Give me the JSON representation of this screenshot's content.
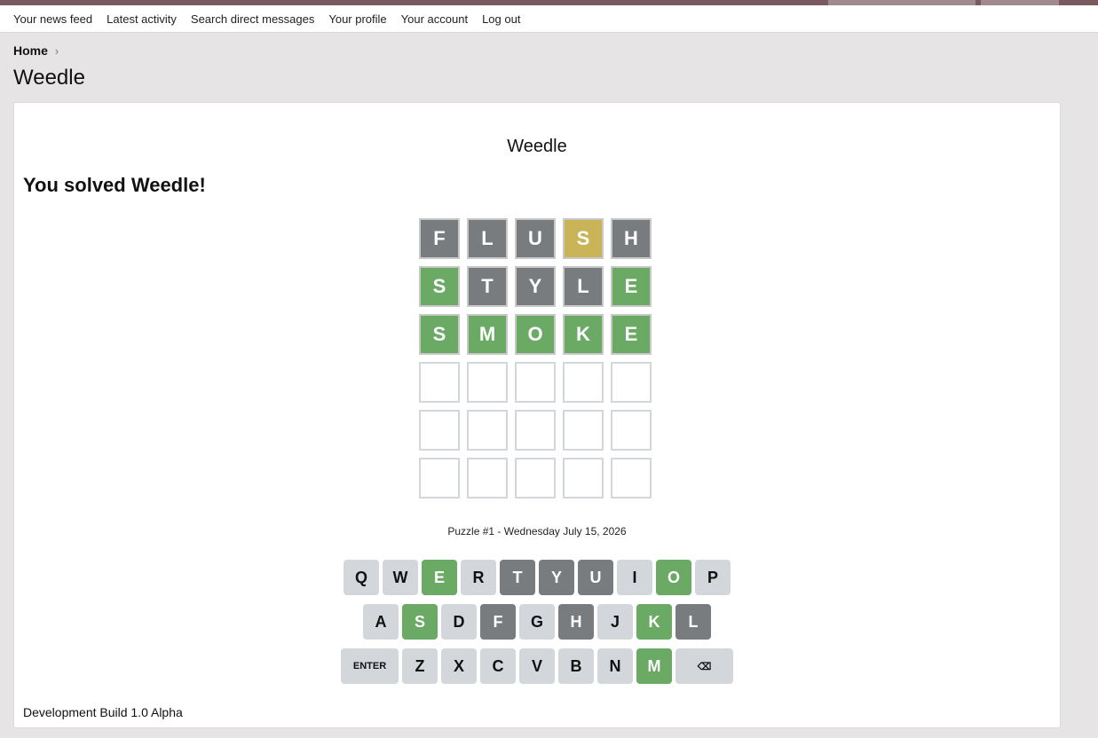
{
  "nav": {
    "items": [
      "Your news feed",
      "Latest activity",
      "Search direct messages",
      "Your profile",
      "Your account",
      "Log out"
    ]
  },
  "breadcrumb": {
    "home": "Home",
    "chevron": "›"
  },
  "page": {
    "title": "Weedle"
  },
  "game": {
    "title": "Weedle",
    "solved_message": "You solved Weedle!",
    "board": [
      [
        {
          "l": "F",
          "s": "grey"
        },
        {
          "l": "L",
          "s": "grey"
        },
        {
          "l": "U",
          "s": "grey"
        },
        {
          "l": "S",
          "s": "yellow"
        },
        {
          "l": "H",
          "s": "grey"
        }
      ],
      [
        {
          "l": "S",
          "s": "green"
        },
        {
          "l": "T",
          "s": "grey"
        },
        {
          "l": "Y",
          "s": "grey"
        },
        {
          "l": "L",
          "s": "grey"
        },
        {
          "l": "E",
          "s": "green"
        }
      ],
      [
        {
          "l": "S",
          "s": "green"
        },
        {
          "l": "M",
          "s": "green"
        },
        {
          "l": "O",
          "s": "green"
        },
        {
          "l": "K",
          "s": "green"
        },
        {
          "l": "E",
          "s": "green"
        }
      ],
      [
        {
          "l": "",
          "s": "empty"
        },
        {
          "l": "",
          "s": "empty"
        },
        {
          "l": "",
          "s": "empty"
        },
        {
          "l": "",
          "s": "empty"
        },
        {
          "l": "",
          "s": "empty"
        }
      ],
      [
        {
          "l": "",
          "s": "empty"
        },
        {
          "l": "",
          "s": "empty"
        },
        {
          "l": "",
          "s": "empty"
        },
        {
          "l": "",
          "s": "empty"
        },
        {
          "l": "",
          "s": "empty"
        }
      ],
      [
        {
          "l": "",
          "s": "empty"
        },
        {
          "l": "",
          "s": "empty"
        },
        {
          "l": "",
          "s": "empty"
        },
        {
          "l": "",
          "s": "empty"
        },
        {
          "l": "",
          "s": "empty"
        }
      ]
    ],
    "puzzle_label": "Puzzle #1 - Wednesday July 15, 2026",
    "keyboard": [
      [
        {
          "k": "Q",
          "s": ""
        },
        {
          "k": "W",
          "s": ""
        },
        {
          "k": "E",
          "s": "green"
        },
        {
          "k": "R",
          "s": ""
        },
        {
          "k": "T",
          "s": "grey"
        },
        {
          "k": "Y",
          "s": "grey"
        },
        {
          "k": "U",
          "s": "grey"
        },
        {
          "k": "I",
          "s": ""
        },
        {
          "k": "O",
          "s": "green"
        },
        {
          "k": "P",
          "s": ""
        }
      ],
      [
        {
          "k": "A",
          "s": ""
        },
        {
          "k": "S",
          "s": "green"
        },
        {
          "k": "D",
          "s": ""
        },
        {
          "k": "F",
          "s": "grey"
        },
        {
          "k": "G",
          "s": ""
        },
        {
          "k": "H",
          "s": "grey"
        },
        {
          "k": "J",
          "s": ""
        },
        {
          "k": "K",
          "s": "green"
        },
        {
          "k": "L",
          "s": "grey"
        }
      ],
      [
        {
          "k": "ENTER",
          "s": "",
          "wide": true,
          "name": "enter-key"
        },
        {
          "k": "Z",
          "s": ""
        },
        {
          "k": "X",
          "s": ""
        },
        {
          "k": "C",
          "s": ""
        },
        {
          "k": "V",
          "s": ""
        },
        {
          "k": "B",
          "s": ""
        },
        {
          "k": "N",
          "s": ""
        },
        {
          "k": "M",
          "s": "green"
        },
        {
          "k": "⌫",
          "s": "",
          "wide": true,
          "name": "backspace-icon"
        }
      ]
    ]
  },
  "footer": {
    "build": "Development Build 1.0 Alpha"
  },
  "colors": {
    "tile_green": "#6aaa64",
    "tile_yellow": "#c9b458",
    "tile_grey": "#787c7e",
    "key_default": "#d3d6da"
  }
}
